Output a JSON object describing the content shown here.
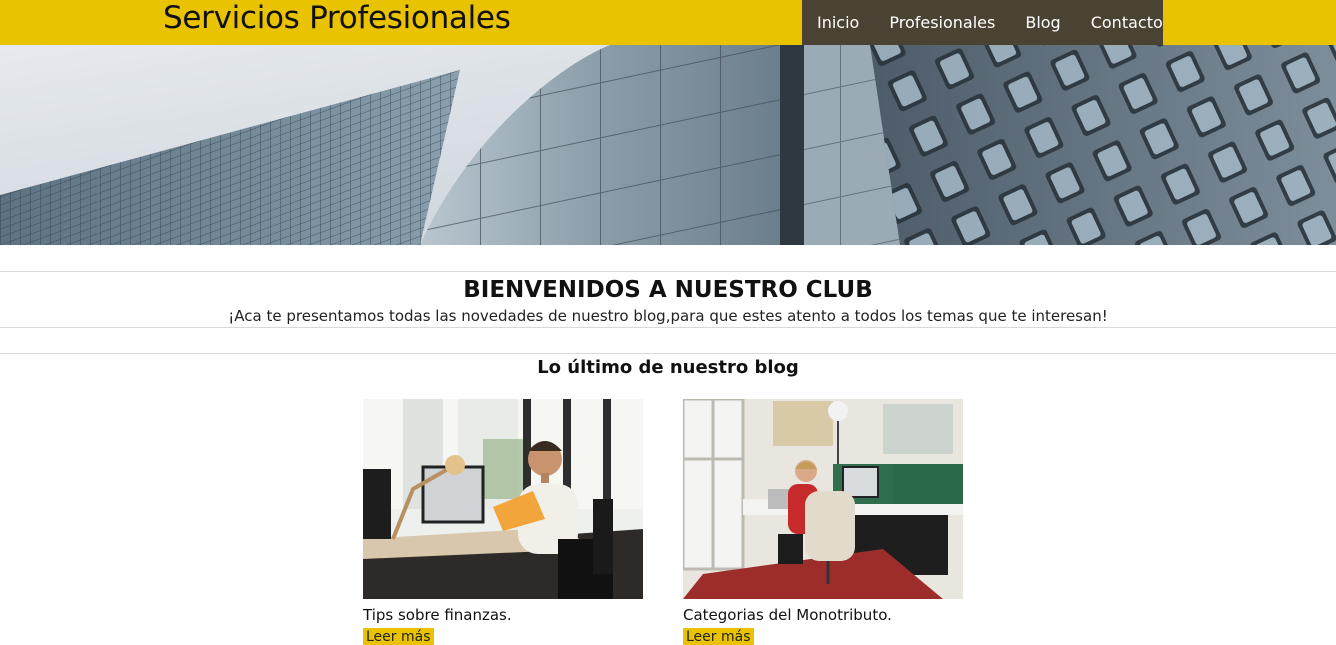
{
  "header": {
    "brand": "Servicios Profesionales",
    "nav": [
      {
        "label": "Inicio"
      },
      {
        "label": "Profesionales"
      },
      {
        "label": "Blog"
      },
      {
        "label": "Contacto"
      }
    ]
  },
  "welcome": {
    "title": "BIENVENIDOS A NUESTRO CLUB",
    "subtitle": "¡Aca te presentamos todas las novedades de nuestro blog,para que estes atento a todos los temas que te interesan!"
  },
  "blog": {
    "heading": "Lo último de nuestro blog",
    "posts": [
      {
        "title": "Tips sobre finanzas.",
        "link": "Leer más"
      },
      {
        "title": "Categorias del Monotributo.",
        "link": "Leer más"
      }
    ]
  },
  "colors": {
    "accent": "#e9c200",
    "nav_bg": "#4a4233"
  }
}
